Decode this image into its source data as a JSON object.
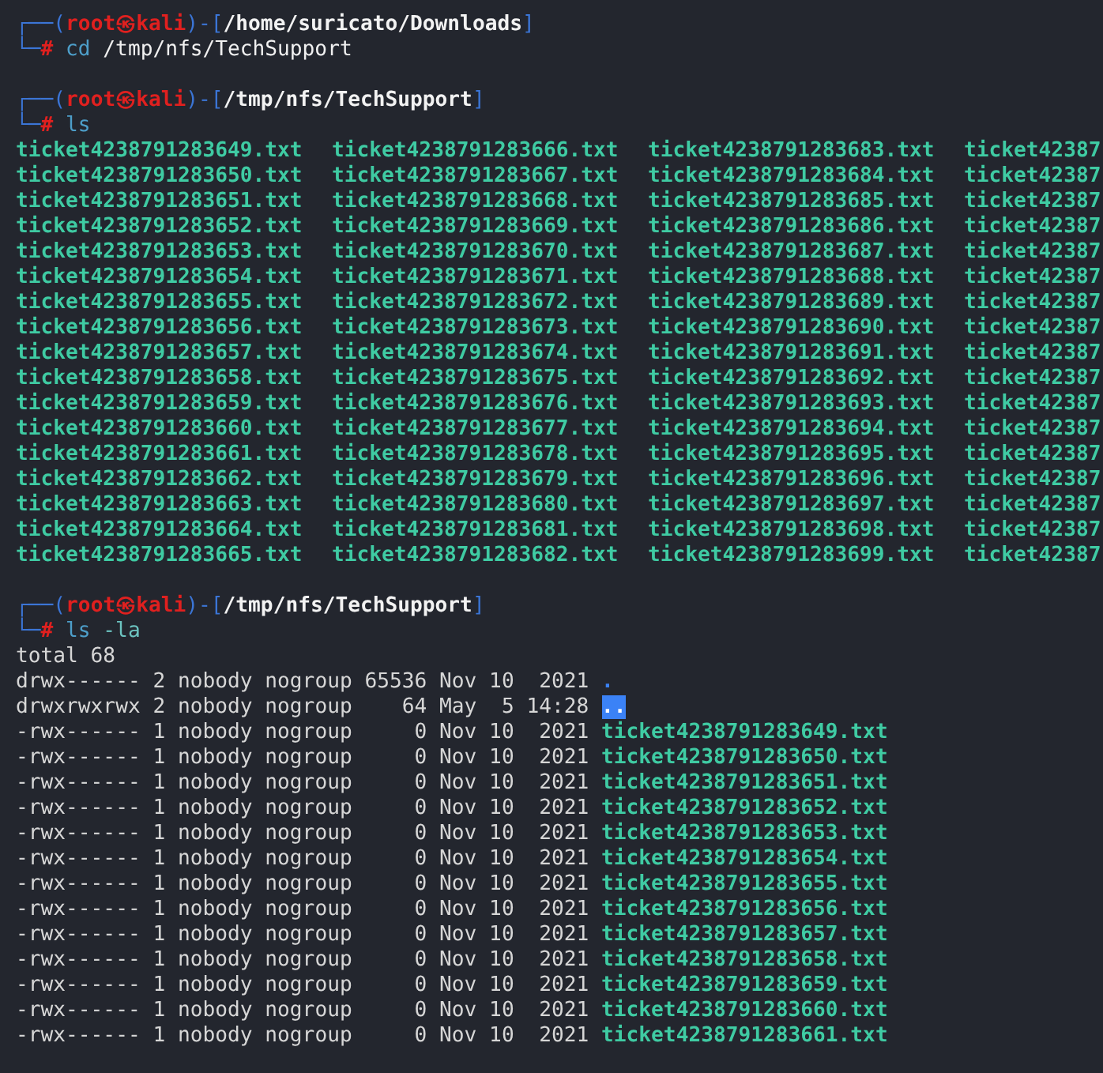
{
  "blocks": [
    {
      "kind": "prompt",
      "lines": [
        [
          {
            "kind": "frame",
            "text": "┌──("
          },
          {
            "kind": "user",
            "text": "root㉿kali"
          },
          {
            "kind": "frame",
            "text": ")-["
          },
          {
            "kind": "path",
            "text": "/home/suricato/Downloads"
          },
          {
            "kind": "frame",
            "text": "]"
          }
        ],
        [
          {
            "kind": "frame",
            "text": "└─"
          },
          {
            "kind": "hash",
            "text": "#"
          },
          {
            "kind": "program",
            "text": "cd"
          },
          {
            "kind": "args",
            "text": "/tmp/nfs/TechSupport"
          }
        ]
      ]
    },
    {
      "kind": "prompt",
      "lines": [
        [
          {
            "kind": "frame",
            "text": "┌──("
          },
          {
            "kind": "user",
            "text": "root㉿kali"
          },
          {
            "kind": "frame",
            "text": ")-["
          },
          {
            "kind": "path",
            "text": "/tmp/nfs/TechSupport"
          },
          {
            "kind": "frame",
            "text": "]"
          }
        ],
        [
          {
            "kind": "frame",
            "text": "└─"
          },
          {
            "kind": "hash",
            "text": "#"
          },
          {
            "kind": "program",
            "text": "ls"
          }
        ]
      ]
    },
    {
      "kind": "grid",
      "rows": [
        [
          "ticket4238791283649.txt",
          "ticket4238791283666.txt",
          "ticket4238791283683.txt",
          "ticket42387"
        ],
        [
          "ticket4238791283650.txt",
          "ticket4238791283667.txt",
          "ticket4238791283684.txt",
          "ticket42387"
        ],
        [
          "ticket4238791283651.txt",
          "ticket4238791283668.txt",
          "ticket4238791283685.txt",
          "ticket42387"
        ],
        [
          "ticket4238791283652.txt",
          "ticket4238791283669.txt",
          "ticket4238791283686.txt",
          "ticket42387"
        ],
        [
          "ticket4238791283653.txt",
          "ticket4238791283670.txt",
          "ticket4238791283687.txt",
          "ticket42387"
        ],
        [
          "ticket4238791283654.txt",
          "ticket4238791283671.txt",
          "ticket4238791283688.txt",
          "ticket42387"
        ],
        [
          "ticket4238791283655.txt",
          "ticket4238791283672.txt",
          "ticket4238791283689.txt",
          "ticket42387"
        ],
        [
          "ticket4238791283656.txt",
          "ticket4238791283673.txt",
          "ticket4238791283690.txt",
          "ticket42387"
        ],
        [
          "ticket4238791283657.txt",
          "ticket4238791283674.txt",
          "ticket4238791283691.txt",
          "ticket42387"
        ],
        [
          "ticket4238791283658.txt",
          "ticket4238791283675.txt",
          "ticket4238791283692.txt",
          "ticket42387"
        ],
        [
          "ticket4238791283659.txt",
          "ticket4238791283676.txt",
          "ticket4238791283693.txt",
          "ticket42387"
        ],
        [
          "ticket4238791283660.txt",
          "ticket4238791283677.txt",
          "ticket4238791283694.txt",
          "ticket42387"
        ],
        [
          "ticket4238791283661.txt",
          "ticket4238791283678.txt",
          "ticket4238791283695.txt",
          "ticket42387"
        ],
        [
          "ticket4238791283662.txt",
          "ticket4238791283679.txt",
          "ticket4238791283696.txt",
          "ticket42387"
        ],
        [
          "ticket4238791283663.txt",
          "ticket4238791283680.txt",
          "ticket4238791283697.txt",
          "ticket42387"
        ],
        [
          "ticket4238791283664.txt",
          "ticket4238791283681.txt",
          "ticket4238791283698.txt",
          "ticket42387"
        ],
        [
          "ticket4238791283665.txt",
          "ticket4238791283682.txt",
          "ticket4238791283699.txt",
          "ticket42387"
        ]
      ]
    },
    {
      "kind": "prompt",
      "lines": [
        [
          {
            "kind": "frame",
            "text": "┌──("
          },
          {
            "kind": "user",
            "text": "root㉿kali"
          },
          {
            "kind": "frame",
            "text": ")-["
          },
          {
            "kind": "path",
            "text": "/tmp/nfs/TechSupport"
          },
          {
            "kind": "frame",
            "text": "]"
          }
        ],
        [
          {
            "kind": "frame",
            "text": "└─"
          },
          {
            "kind": "hash",
            "text": "#"
          },
          {
            "kind": "program",
            "text": "ls"
          },
          {
            "kind": "flag",
            "text": "-la"
          }
        ]
      ]
    },
    {
      "kind": "listing",
      "total": "total 68",
      "entries": [
        {
          "kind": "dir",
          "details": [
            "drwx------",
            "2",
            "nobody",
            "nogroup",
            "65536",
            "Nov",
            "10",
            "2021"
          ],
          "name": "."
        },
        {
          "kind": "dir_writable",
          "details": [
            "drwxrwxrwx",
            "2",
            "nobody",
            "nogroup",
            "64",
            "May",
            "5",
            "14:28"
          ],
          "name": ".."
        },
        {
          "kind": "exec",
          "details": [
            "-rwx------",
            "1",
            "nobody",
            "nogroup",
            "0",
            "Nov",
            "10",
            "2021"
          ],
          "name": "ticket4238791283649.txt"
        },
        {
          "kind": "exec",
          "details": [
            "-rwx------",
            "1",
            "nobody",
            "nogroup",
            "0",
            "Nov",
            "10",
            "2021"
          ],
          "name": "ticket4238791283650.txt"
        },
        {
          "kind": "exec",
          "details": [
            "-rwx------",
            "1",
            "nobody",
            "nogroup",
            "0",
            "Nov",
            "10",
            "2021"
          ],
          "name": "ticket4238791283651.txt"
        },
        {
          "kind": "exec",
          "details": [
            "-rwx------",
            "1",
            "nobody",
            "nogroup",
            "0",
            "Nov",
            "10",
            "2021"
          ],
          "name": "ticket4238791283652.txt"
        },
        {
          "kind": "exec",
          "details": [
            "-rwx------",
            "1",
            "nobody",
            "nogroup",
            "0",
            "Nov",
            "10",
            "2021"
          ],
          "name": "ticket4238791283653.txt"
        },
        {
          "kind": "exec",
          "details": [
            "-rwx------",
            "1",
            "nobody",
            "nogroup",
            "0",
            "Nov",
            "10",
            "2021"
          ],
          "name": "ticket4238791283654.txt"
        },
        {
          "kind": "exec",
          "details": [
            "-rwx------",
            "1",
            "nobody",
            "nogroup",
            "0",
            "Nov",
            "10",
            "2021"
          ],
          "name": "ticket4238791283655.txt"
        },
        {
          "kind": "exec",
          "details": [
            "-rwx------",
            "1",
            "nobody",
            "nogroup",
            "0",
            "Nov",
            "10",
            "2021"
          ],
          "name": "ticket4238791283656.txt"
        },
        {
          "kind": "exec",
          "details": [
            "-rwx------",
            "1",
            "nobody",
            "nogroup",
            "0",
            "Nov",
            "10",
            "2021"
          ],
          "name": "ticket4238791283657.txt"
        },
        {
          "kind": "exec",
          "details": [
            "-rwx------",
            "1",
            "nobody",
            "nogroup",
            "0",
            "Nov",
            "10",
            "2021"
          ],
          "name": "ticket4238791283658.txt"
        },
        {
          "kind": "exec",
          "details": [
            "-rwx------",
            "1",
            "nobody",
            "nogroup",
            "0",
            "Nov",
            "10",
            "2021"
          ],
          "name": "ticket4238791283659.txt"
        },
        {
          "kind": "exec",
          "details": [
            "-rwx------",
            "1",
            "nobody",
            "nogroup",
            "0",
            "Nov",
            "10",
            "2021"
          ],
          "name": "ticket4238791283660.txt"
        },
        {
          "kind": "exec",
          "details": [
            "-rwx------",
            "1",
            "nobody",
            "nogroup",
            "0",
            "Nov",
            "10",
            "2021"
          ],
          "name": "ticket4238791283661.txt"
        }
      ]
    }
  ]
}
